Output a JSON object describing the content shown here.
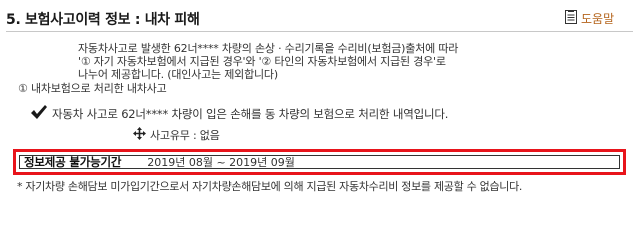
{
  "header": {
    "title": "5. 보험사고이력 정보 : 내차 피해",
    "help_label": "도움말"
  },
  "description": {
    "line1": "자동차사고로 발생한 62너**** 차량의 손상 · 수리기록을 수리비(보험금)출처에 따라",
    "line2": "'① 자기 자동차보험에서 지급된 경우'와 '② 타인의 자동차보험에서 지급된 경우'로",
    "line3": "나누어 제공합니다. (대인사고는 제외합니다)",
    "section_label": "① 내차보험으로 처리한 내차사고"
  },
  "check_text": "자동차 사고로 62너**** 차량이 입은 손해를 동 차량의 보험으로 처리한 내역입니다.",
  "accident": {
    "text": "사고유무 : 없음"
  },
  "period": {
    "label": "정보제공 불가능기간",
    "value": "2019년 08월 ~ 2019년 09월"
  },
  "footnote": "* 자기차량 손해담보 미가입기간으로서 자기차량손해담보에 의해 지급된 자동차수리비 정보를 제공할 수 없습니다.",
  "colors": {
    "highlight_border": "#e8141b",
    "help_text": "#b5651d"
  },
  "icons": {
    "help": "document-icon",
    "check": "check-icon",
    "accident": "move-arrows-icon"
  }
}
